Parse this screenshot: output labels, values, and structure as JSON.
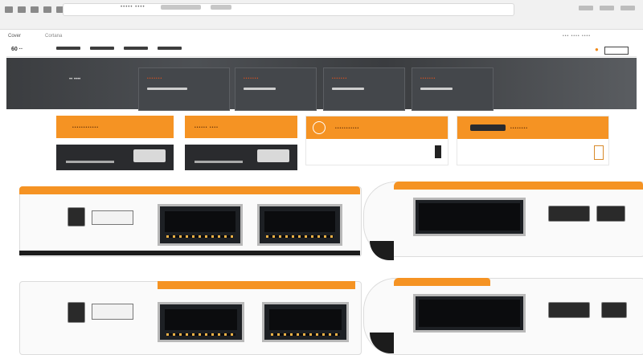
{
  "browser": {
    "title_text": "0·S",
    "address_text": "••••• ••••",
    "crumb_left": "Cover",
    "crumb_right": "Cortana",
    "right_tools": "••• •••• ••••"
  },
  "site": {
    "logo": "60 ··",
    "nav_items": [
      "",
      "",
      "",
      ""
    ],
    "cart_icon": "cart-icon",
    "search_icon": "search-icon"
  },
  "hero": {
    "text": "•• ••••",
    "cards": [
      {
        "title": "•••••••"
      },
      {
        "title": "•••••••"
      },
      {
        "title": "•••••••"
      },
      {
        "title": "•••••••"
      }
    ]
  },
  "promos": [
    {
      "label": "••••••••••••"
    },
    {
      "label": "•••••• ••••"
    },
    {
      "label": "•••••••••••"
    },
    {
      "label": "••••••••"
    }
  ],
  "colors": {
    "accent": "#f59323",
    "dark": "#2a2b2e",
    "device_body": "#fafafa"
  }
}
